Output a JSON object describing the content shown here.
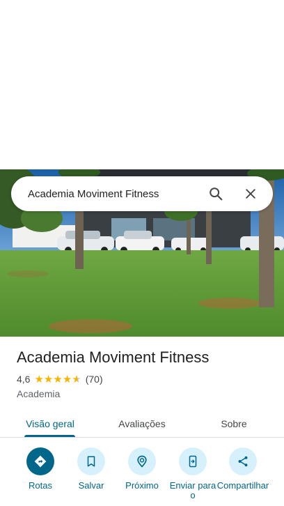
{
  "search": {
    "query": "Academia Moviment Fitness"
  },
  "place": {
    "name": "Academia Moviment Fitness",
    "rating": "4,6",
    "stars": 4.6,
    "review_count": "(70)",
    "category": "Academia"
  },
  "tabs": [
    {
      "label": "Visão geral",
      "active": true
    },
    {
      "label": "Avaliações",
      "active": false
    },
    {
      "label": "Sobre",
      "active": false
    }
  ],
  "actions": [
    {
      "label": "Rotas",
      "icon": "directions-icon"
    },
    {
      "label": "Salvar",
      "icon": "bookmark-icon"
    },
    {
      "label": "Próximo",
      "icon": "nearby-icon"
    },
    {
      "label": "Enviar para o",
      "icon": "send-to-phone-icon"
    },
    {
      "label": "Compartilhar",
      "icon": "share-icon"
    }
  ],
  "colors": {
    "accent": "#00668a",
    "action_bg": "#d6f1fb",
    "star": "#f4b400"
  }
}
